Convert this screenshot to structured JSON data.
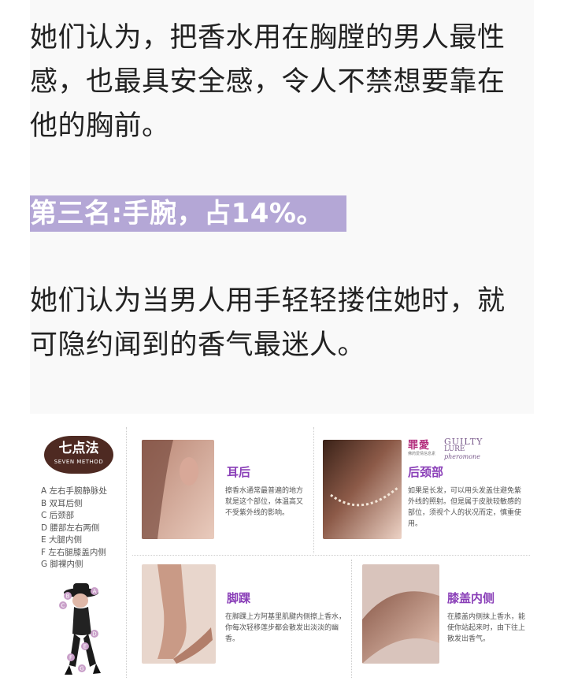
{
  "article": {
    "paragraph_1": "她们认为，把香水用在胸膛的男人最性感，也最具安全感，令人不禁想要靠在他的胸前。",
    "heading": "第三名:手腕，占14%。",
    "paragraph_2": "她们认为当男人用手轻轻搂住她时，就可隐约闻到的香气最迷人。"
  },
  "infographic": {
    "badge_title": "七点法",
    "badge_subtitle": "SEVEN METHOD",
    "methods": [
      "A  左右手腕静脉处",
      "B  双耳后侧",
      "C  后颈部",
      "D  腰部左右两侧",
      "E  大腿内侧",
      "F  左右腿膝盖内侧",
      "G  脚裸内侧"
    ],
    "figure_markers": [
      "A",
      "B",
      "C",
      "D",
      "E",
      "F",
      "G"
    ],
    "logo": {
      "cn": "罪愛",
      "en_1": "GUILTY",
      "en_2": "LURE",
      "cn_small": "佛药爱情信息素",
      "en_3": "pheromone"
    },
    "panels": [
      {
        "title": "耳后",
        "text": "擦香水通常最普遍的地方就是这个部位，体温高又不受紫外线的影响。"
      },
      {
        "title": "后颈部",
        "text": "如果是长发，可以用头发盖住避免紫外线的照射。但是属于皮肤较敏感的部位，须视个人的状况而定，慎重使用。"
      },
      {
        "title": "脚踝",
        "text": "在脚踝上方阿基里肌腱内侧擦上香水，你每次轻移莲步都会散发出淡淡的幽香。"
      },
      {
        "title": "膝盖内侧",
        "text": "在膝盖内侧抹上香水，能使你站起来时，由下往上散发出香气。"
      }
    ],
    "colors": {
      "accent": "#8a3fb8",
      "badge": "#4e2a22",
      "heading_bg": "#b4a7d6"
    }
  }
}
